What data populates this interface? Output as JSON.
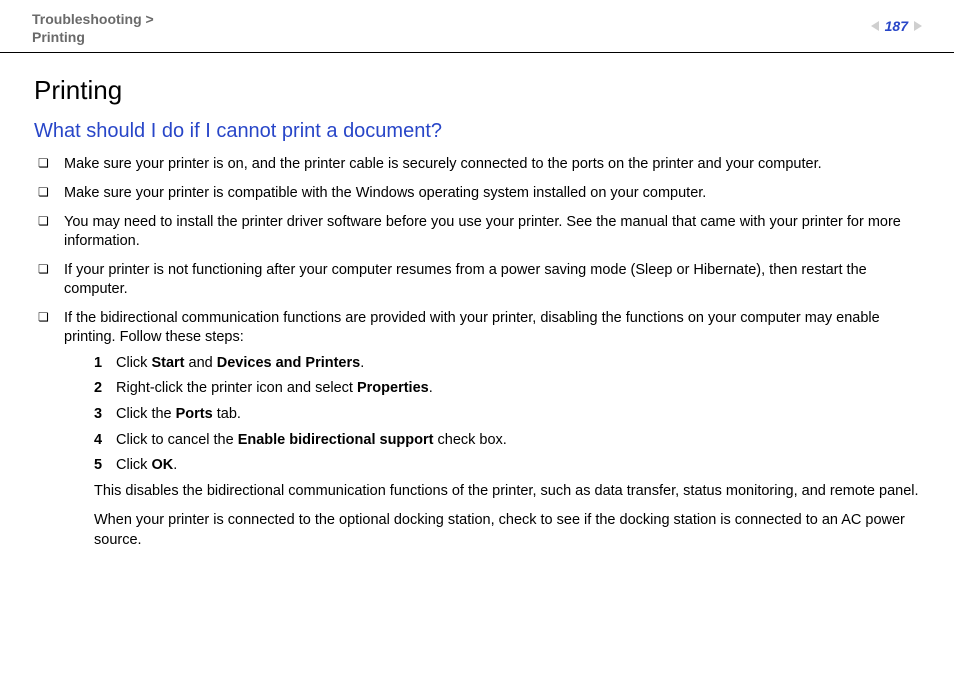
{
  "header": {
    "breadcrumb_parent": "Troubleshooting",
    "breadcrumb_separator": ">",
    "breadcrumb_child": "Printing",
    "page_number": "187"
  },
  "content": {
    "section_title": "Printing",
    "question": "What should I do if I cannot print a document?",
    "bullets": [
      "Make sure your printer is on, and the printer cable is securely connected to the ports on the printer and your computer.",
      "Make sure your printer is compatible with the Windows operating system installed on your computer.",
      "You may need to install the printer driver software before you use your printer. See the manual that came with your printer for more information.",
      "If your printer is not functioning after your computer resumes from a power saving mode (Sleep or Hibernate), then restart the computer.",
      "If the bidirectional communication functions are provided with your printer, disabling the functions on your computer may enable printing. Follow these steps:"
    ],
    "steps": [
      {
        "num": "1",
        "prefix": "Click ",
        "bold1": "Start",
        "mid": " and ",
        "bold2": "Devices and Printers",
        "suffix": "."
      },
      {
        "num": "2",
        "prefix": "Right-click the printer icon and select ",
        "bold1": "Properties",
        "mid": "",
        "bold2": "",
        "suffix": "."
      },
      {
        "num": "3",
        "prefix": "Click the ",
        "bold1": "Ports",
        "mid": "",
        "bold2": "",
        "suffix": " tab."
      },
      {
        "num": "4",
        "prefix": "Click to cancel the ",
        "bold1": "Enable bidirectional support",
        "mid": "",
        "bold2": "",
        "suffix": " check box."
      },
      {
        "num": "5",
        "prefix": "Click ",
        "bold1": "OK",
        "mid": "",
        "bold2": "",
        "suffix": "."
      }
    ],
    "after_steps": [
      "This disables the bidirectional communication functions of the printer, such as data transfer, status monitoring, and remote panel.",
      "When your printer is connected to the optional docking station, check to see if the docking station is connected to an AC power source."
    ]
  }
}
